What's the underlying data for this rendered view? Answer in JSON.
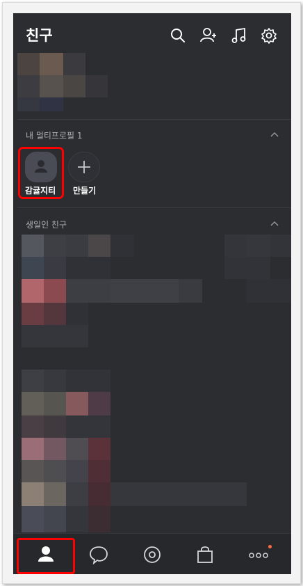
{
  "header": {
    "title": "친구",
    "icons": [
      "search-icon",
      "add-friend-icon",
      "music-icon",
      "settings-icon"
    ]
  },
  "multi_profile": {
    "section_label": "내 멀티프로필 1",
    "profile_name": "감귤지티",
    "create_label": "만들기"
  },
  "birthday": {
    "section_label": "생일인 친구"
  },
  "tabbar": {
    "tabs": [
      "friends-tab",
      "chat-tab",
      "view-tab",
      "shopping-tab",
      "more-tab"
    ],
    "active": "friends-tab"
  },
  "colors": {
    "background": "#2c2d31",
    "highlight": "#ff0000",
    "badge": "#ff6b3d"
  }
}
